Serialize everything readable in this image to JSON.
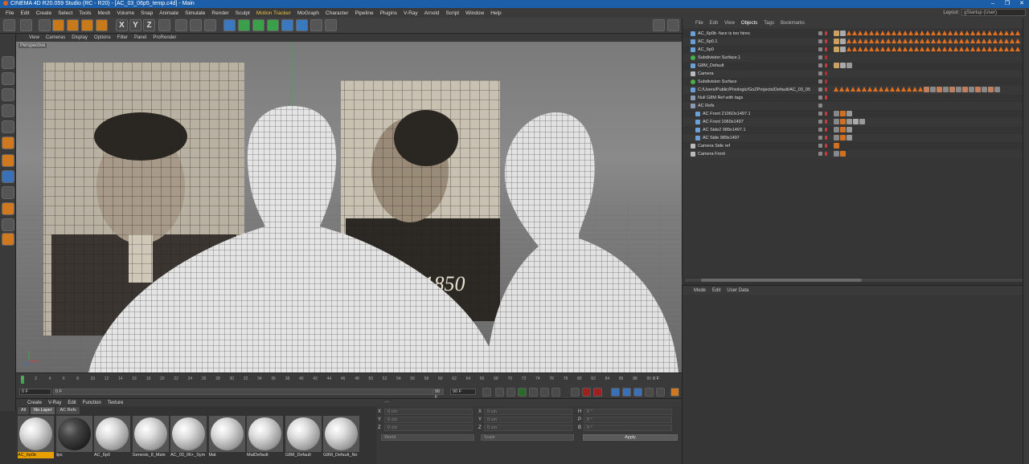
{
  "window": {
    "title": "CINEMA 4D R20.059 Studio (RC - R20) - [AC_03_06p5_temp.c4d] - Main",
    "controls": [
      "–",
      "❐",
      "✕"
    ]
  },
  "menubar": {
    "items": [
      "File",
      "Edit",
      "Create",
      "Select",
      "Tools",
      "Mesh",
      "Volume",
      "Snap",
      "Animate",
      "Simulate",
      "Render",
      "Sculpt",
      "Motion Tracker",
      "MoGraph",
      "Character",
      "Pipeline",
      "Plugins",
      "V-Ray",
      "Arnold",
      "Script",
      "Window",
      "Help"
    ],
    "highlight": "Motion Tracker",
    "layout_label": "Layout:",
    "layout_value": "gStartup (User)"
  },
  "toolbar": {
    "axis_letters": [
      "X",
      "Y",
      "Z"
    ]
  },
  "viewport": {
    "menu": [
      "View",
      "Cameras",
      "Display",
      "Options",
      "Filter",
      "Panel",
      "ProRender"
    ],
    "label": "Perspective",
    "stamp_text": "ed1850"
  },
  "timeline": {
    "ticks": [
      "0",
      "2",
      "4",
      "6",
      "8",
      "10",
      "12",
      "14",
      "16",
      "18",
      "20",
      "22",
      "24",
      "26",
      "28",
      "30",
      "32",
      "34",
      "36",
      "38",
      "40",
      "42",
      "44",
      "46",
      "48",
      "50",
      "52",
      "54",
      "56",
      "58",
      "60",
      "62",
      "64",
      "66",
      "68",
      "70",
      "72",
      "74",
      "76",
      "78",
      "80",
      "82",
      "84",
      "86",
      "88",
      "90"
    ],
    "current_frame": "0 F",
    "start_field": "0 F",
    "start_field2": "0 F",
    "end_field": "90 F",
    "end_field2": "90 F"
  },
  "material_manager": {
    "menu": [
      "Create",
      "V-Ray",
      "Edit",
      "Function",
      "Texture"
    ],
    "filters": [
      "All",
      "No Layer",
      "AC Refs"
    ],
    "active_filter": "No Layer",
    "materials": [
      {
        "name": "AC_6p0b",
        "dark": false,
        "selected": true
      },
      {
        "name": "lips",
        "dark": true,
        "selected": false
      },
      {
        "name": "AC_6p0",
        "dark": false,
        "selected": false
      },
      {
        "name": "Genesis_8_Male",
        "dark": false,
        "selected": false
      },
      {
        "name": "AC_03_06+_Sym",
        "dark": false,
        "selected": false
      },
      {
        "name": "Mat",
        "dark": false,
        "selected": false
      },
      {
        "name": "MatDefault",
        "dark": false,
        "selected": false
      },
      {
        "name": "G8M_Default",
        "dark": false,
        "selected": false
      },
      {
        "name": "G8M_Default_No",
        "dark": false,
        "selected": false
      }
    ]
  },
  "coordinates": {
    "head_dashes": "---",
    "rows": [
      {
        "a": "X",
        "av": "0 cm",
        "b": "X",
        "bv": "0 cm",
        "c": "H",
        "cv": "0 °"
      },
      {
        "a": "Y",
        "av": "0 cm",
        "b": "Y",
        "bv": "0 cm",
        "c": "P",
        "cv": "0 °"
      },
      {
        "a": "Z",
        "av": "0 cm",
        "b": "Z",
        "bv": "0 cm",
        "c": "B",
        "cv": "0 °"
      }
    ],
    "mode1": "World",
    "mode2": "Scale",
    "apply": "Apply"
  },
  "object_manager": {
    "menu": [
      "File",
      "Edit",
      "View",
      "Objects",
      "Tags",
      "Bookmarks"
    ],
    "active": "Objects",
    "rows": [
      {
        "name": "AC_6p0b -face is too hires",
        "indent": 0,
        "icon": "polygon",
        "dot2": "red",
        "tags": "tri-long"
      },
      {
        "name": "AC_6p0.1",
        "indent": 0,
        "icon": "polygon",
        "dot2": "red",
        "tags": "tri-long"
      },
      {
        "name": "AC_6p0",
        "indent": 0,
        "icon": "polygon",
        "dot2": "red",
        "tags": "tri-long"
      },
      {
        "name": "Subdivision Surface.1",
        "indent": 0,
        "icon": "green",
        "dot2": "cross",
        "tags": "none"
      },
      {
        "name": "G8M_Default",
        "indent": 0,
        "icon": "polygon",
        "dot2": "red",
        "tags": "few"
      },
      {
        "name": "Camera",
        "indent": 0,
        "icon": "camera",
        "dot2": "cross",
        "tags": "none"
      },
      {
        "name": "Subdivision Surface",
        "indent": 0,
        "icon": "green",
        "dot2": "cross",
        "tags": "none"
      },
      {
        "name": "C:/Users/Public/Pixologic/GoZProjects/Default/AC_03_05",
        "indent": 0,
        "icon": "polygon",
        "dot2": "red",
        "tags": "tri-mixed"
      },
      {
        "name": "Null G8M Ref with tags",
        "indent": 0,
        "icon": "null",
        "dot2": "red",
        "tags": "none"
      },
      {
        "name": "AC Refs",
        "indent": 0,
        "icon": "null",
        "dot2": "none",
        "tags": "none"
      },
      {
        "name": "AC Front 2106Ox1497.1",
        "indent": 1,
        "icon": "polygon",
        "dot2": "red",
        "tags": "ref"
      },
      {
        "name": "AC Front 1060x1497",
        "indent": 1,
        "icon": "polygon",
        "dot2": "red",
        "tags": "ref2"
      },
      {
        "name": "AC Side2 989x1497.1",
        "indent": 1,
        "icon": "polygon",
        "dot2": "red",
        "tags": "ref"
      },
      {
        "name": "AC Side 989x1497",
        "indent": 1,
        "icon": "polygon",
        "dot2": "red",
        "tags": "ref"
      },
      {
        "name": "Camera Side ref",
        "indent": 0,
        "icon": "camera",
        "dot2": "red",
        "tags": "cam"
      },
      {
        "name": "Camera Front",
        "indent": 0,
        "icon": "camera",
        "dot2": "red",
        "tags": "cam2"
      }
    ]
  },
  "attribute_manager": {
    "menu": [
      "Mode",
      "Edit",
      "User Data"
    ]
  },
  "colors": {
    "title_bar": "#1c5ea8",
    "accent_orange": "#e07020",
    "selection": "#e8a000"
  }
}
